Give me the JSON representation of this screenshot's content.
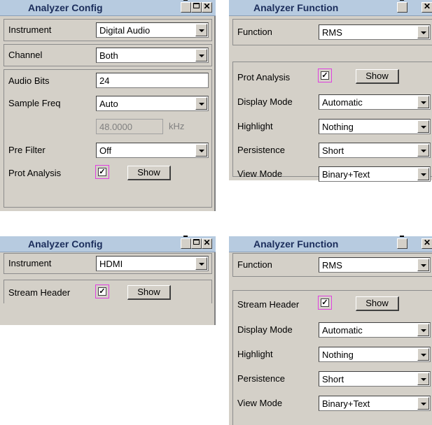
{
  "top_left": {
    "title": "Analyzer Config",
    "instrument": {
      "label": "Instrument",
      "value": "Digital Audio"
    },
    "channel": {
      "label": "Channel",
      "value": "Both"
    },
    "audio_bits": {
      "label": "Audio Bits",
      "value": "24"
    },
    "sample_freq": {
      "label": "Sample Freq",
      "value": "Auto"
    },
    "freq_value": {
      "value": "48.0000",
      "unit": "kHz"
    },
    "pre_filter": {
      "label": "Pre Filter",
      "value": "Off"
    },
    "prot_analysis": {
      "label": "Prot Analysis",
      "checked": true,
      "button": "Show"
    }
  },
  "top_right": {
    "title": "Analyzer Function",
    "function": {
      "label": "Function",
      "value": "RMS"
    },
    "prot_analysis": {
      "label": "Prot Analysis",
      "checked": true,
      "button": "Show"
    },
    "display_mode": {
      "label": "Display Mode",
      "value": "Automatic"
    },
    "highlight": {
      "label": "Highlight",
      "value": "Nothing"
    },
    "persistence": {
      "label": "Persistence",
      "value": "Short"
    },
    "view_mode": {
      "label": "View Mode",
      "value": "Binary+Text"
    }
  },
  "bottom_left": {
    "title": "Analyzer Config",
    "instrument": {
      "label": "Instrument",
      "value": "HDMI"
    },
    "stream_header": {
      "label": "Stream Header",
      "checked": true,
      "button": "Show"
    }
  },
  "bottom_right": {
    "title": "Analyzer Function",
    "function": {
      "label": "Function",
      "value": "RMS"
    },
    "stream_header": {
      "label": "Stream Header",
      "checked": true,
      "button": "Show"
    },
    "display_mode": {
      "label": "Display Mode",
      "value": "Automatic"
    },
    "highlight": {
      "label": "Highlight",
      "value": "Nothing"
    },
    "persistence": {
      "label": "Persistence",
      "value": "Short"
    },
    "view_mode": {
      "label": "View Mode",
      "value": "Binary+Text"
    }
  },
  "icons": {
    "check": "✓",
    "close": "✕"
  },
  "colors": {
    "titlebar": "#b7cbe0",
    "panel": "#d4d0c8",
    "highlight": "#e040e0"
  }
}
